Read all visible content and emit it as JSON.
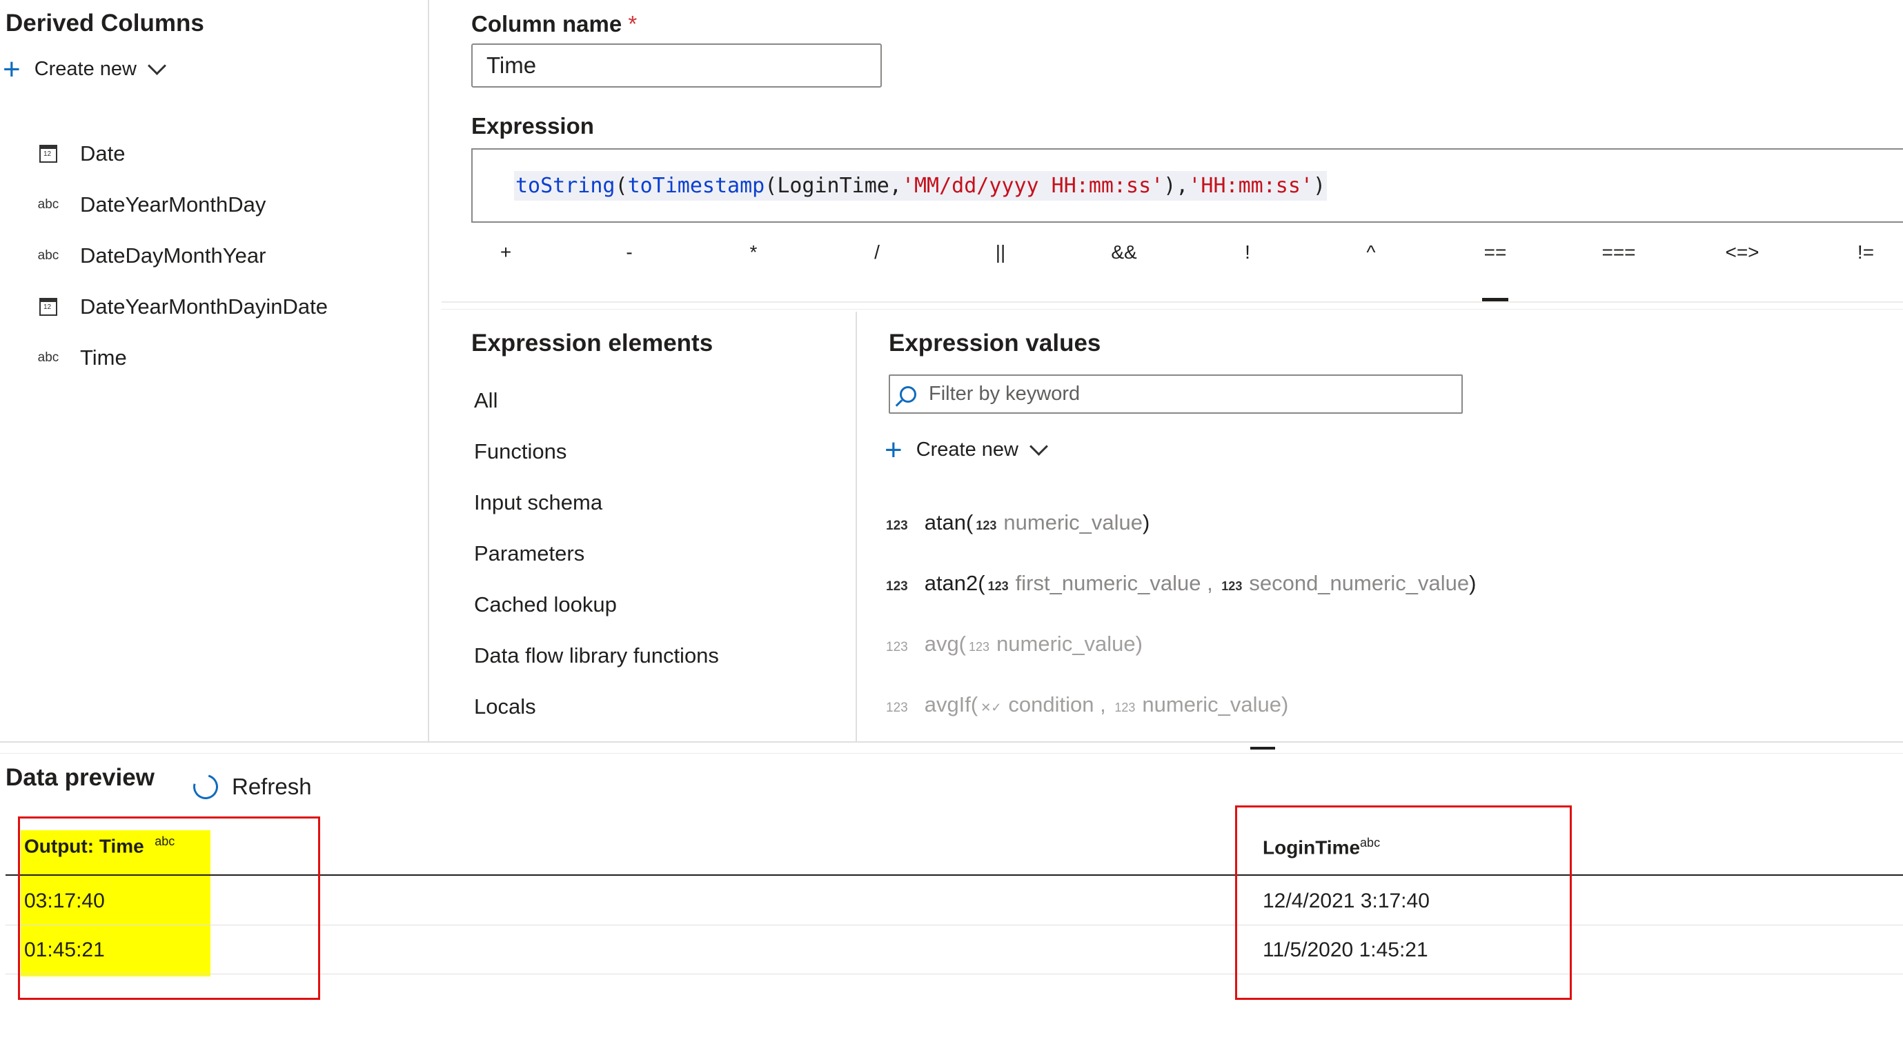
{
  "derived_columns": {
    "title": "Derived Columns",
    "create_new_label": "Create new",
    "columns": [
      {
        "type": "date",
        "type_label": "12",
        "name": "Date"
      },
      {
        "type": "string",
        "type_label": "abc",
        "name": "DateYearMonthDay"
      },
      {
        "type": "string",
        "type_label": "abc",
        "name": "DateDayMonthYear"
      },
      {
        "type": "date",
        "type_label": "12",
        "name": "DateYearMonthDayinDate"
      },
      {
        "type": "string",
        "type_label": "abc",
        "name": "Time"
      }
    ]
  },
  "column_name": {
    "label": "Column name",
    "required_mark": "*",
    "value": "Time"
  },
  "expression": {
    "label": "Expression",
    "tokens": {
      "fn1": "toString",
      "p1": "(",
      "fn2": "toTimestamp",
      "p2": "(",
      "id1": "LoginTime",
      "c1": ",",
      "s1": "'MM/dd/yyyy HH:mm:ss'",
      "p3": "),",
      "s2": "'HH:mm:ss'",
      "p4": ")"
    }
  },
  "operators": [
    "+",
    "-",
    "*",
    "/",
    "||",
    "&&",
    "!",
    "^",
    "==",
    "===",
    "<=>",
    "!="
  ],
  "expression_elements": {
    "title": "Expression elements",
    "items": [
      "All",
      "Functions",
      "Input schema",
      "Parameters",
      "Cached lookup",
      "Data flow library functions",
      "Locals"
    ]
  },
  "expression_values": {
    "title": "Expression values",
    "filter_placeholder": "Filter by keyword",
    "create_new_label": "Create new",
    "type_badge": "123",
    "condition_badge": "✕✓",
    "items": [
      {
        "fn": "atan(",
        "p1": "numeric_value",
        "sep": "",
        "p2": "",
        "close": ")",
        "enabled": true
      },
      {
        "fn": "atan2(",
        "p1": "first_numeric_value",
        "sep": " , ",
        "p2": "second_numeric_value",
        "close": ")",
        "enabled": true
      },
      {
        "fn": "avg(",
        "p1": "numeric_value",
        "sep": "",
        "p2": "",
        "close": ")",
        "enabled": false
      },
      {
        "fn": "avgIf(",
        "p1": "condition",
        "sep": " , ",
        "p2": "numeric_value",
        "close": ")",
        "enabled": false
      }
    ]
  },
  "data_preview": {
    "title": "Data preview",
    "refresh_label": "Refresh",
    "columns": [
      {
        "header": "Output: Time",
        "type": "abc"
      },
      {
        "header": "LoginTime",
        "type": "abc"
      }
    ],
    "rows": [
      [
        "03:17:40",
        "12/4/2021 3:17:40"
      ],
      [
        "01:45:21",
        "11/5/2020 1:45:21"
      ]
    ],
    "highlight_color": "#ffff00",
    "annotation_color": "#e01010"
  }
}
